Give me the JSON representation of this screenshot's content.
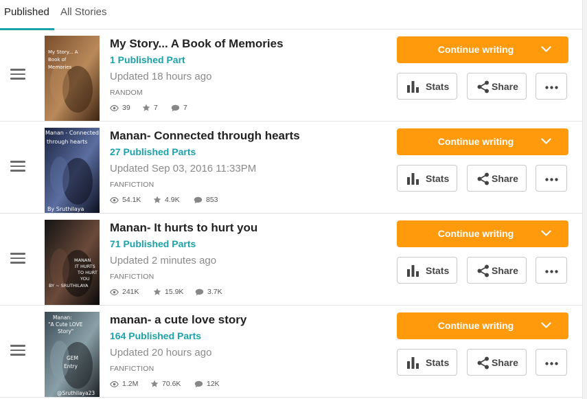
{
  "tabs": [
    {
      "label": "Published",
      "active": true
    },
    {
      "label": "All Stories",
      "active": false
    }
  ],
  "buttons": {
    "continue": "Continue writing",
    "stats": "Stats",
    "share": "Share"
  },
  "colors": {
    "accent": "#1aa1a9",
    "continue": "#ff9a0d"
  },
  "stories": [
    {
      "title": "My Story... A Book of Memories",
      "parts": "1 Published Part",
      "updated": "Updated 18 hours ago",
      "category": "RANDOM",
      "reads": "39",
      "votes": "7",
      "comments": "7",
      "cover_text": [
        "My Story... A",
        "Book of",
        "Memories"
      ]
    },
    {
      "title": "Manan- Connected through hearts",
      "parts": "27 Published Parts",
      "updated": "Updated Sep 03, 2016 11:33PM",
      "category": "FANFICTION",
      "reads": "54.1K",
      "votes": "4.9K",
      "comments": "853",
      "cover_text": [
        "Manan - Connected",
        "through hearts",
        "By Sruthilaya"
      ]
    },
    {
      "title": "Manan- It hurts to hurt you",
      "parts": "71 Published Parts",
      "updated": "Updated 2 minutes ago",
      "category": "FANFICTION",
      "reads": "241K",
      "votes": "15.9K",
      "comments": "3.7K",
      "cover_text": [
        "MANAN",
        "IT HURTS",
        "TO HURT",
        "YOU",
        "BY ~ SRUTHILAYA"
      ]
    },
    {
      "title": "manan- a cute love story",
      "parts": "164 Published Parts",
      "updated": "Updated 20 hours ago",
      "category": "FANFICTION",
      "reads": "1.2M",
      "votes": "70.6K",
      "comments": "12K",
      "cover_text": [
        "Manan:",
        "\"A Cute LOVE",
        "Story\"",
        "GEM",
        "Entry",
        "@Sruthilaya23"
      ]
    }
  ]
}
